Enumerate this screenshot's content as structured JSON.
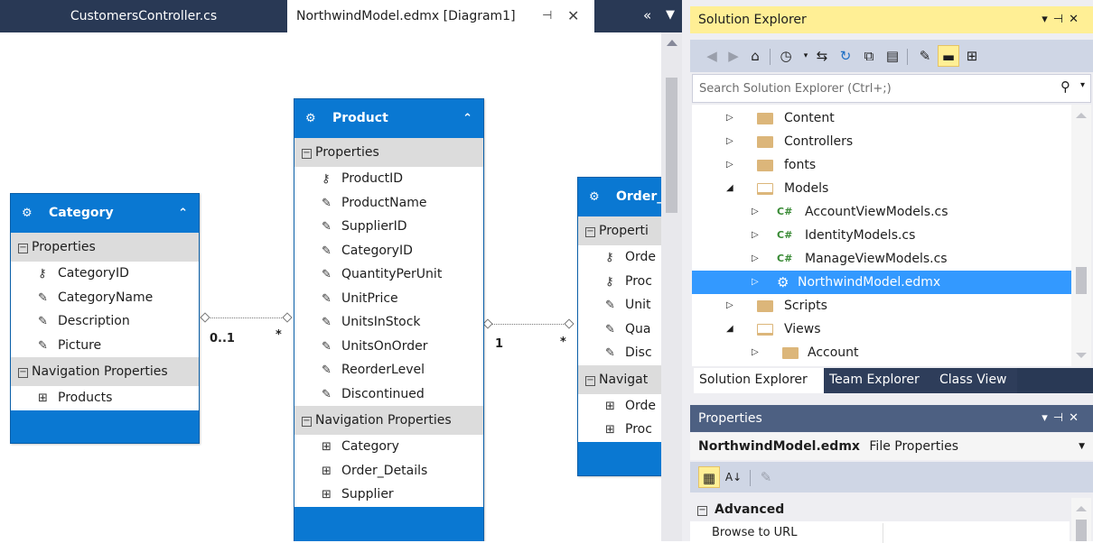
{
  "tabs": {
    "customers": "CustomersController.cs",
    "model": "NorthwindModel.edmx [Diagram1]",
    "pin_icon": "pin-icon",
    "close_icon": "close-icon",
    "overflow": "«",
    "dropdown": "▼"
  },
  "diagram": {
    "entities": {
      "category": {
        "name": "Category",
        "properties_label": "Properties",
        "properties": [
          "CategoryID",
          "CategoryName",
          "Description",
          "Picture"
        ],
        "nav_label": "Navigation Properties",
        "nav": [
          "Products"
        ]
      },
      "product": {
        "name": "Product",
        "properties_label": "Properties",
        "properties": [
          "ProductID",
          "ProductName",
          "SupplierID",
          "CategoryID",
          "QuantityPerUnit",
          "UnitPrice",
          "UnitsInStock",
          "UnitsOnOrder",
          "ReorderLevel",
          "Discontinued"
        ],
        "nav_label": "Navigation Properties",
        "nav": [
          "Category",
          "Order_Details",
          "Supplier"
        ]
      },
      "order": {
        "name": "Order_",
        "properties_label": "Properti",
        "properties": [
          "Orde",
          "Proc",
          "Unit",
          "Qua",
          "Disc"
        ],
        "nav_label": "Navigat",
        "nav": [
          "Orde",
          "Proc"
        ]
      }
    },
    "multiplicities": {
      "cat_side": "0..1",
      "prod_side_left": "*",
      "prod_side_right": "1",
      "order_side": "*"
    }
  },
  "solution_explorer": {
    "title": "Solution Explorer",
    "search_placeholder": "Search Solution Explorer (Ctrl+;)",
    "tree": [
      {
        "label": "Content",
        "type": "folder",
        "level": 1,
        "expanded": false
      },
      {
        "label": "Controllers",
        "type": "folder",
        "level": 1,
        "expanded": false
      },
      {
        "label": "fonts",
        "type": "folder",
        "level": 1,
        "expanded": false
      },
      {
        "label": "Models",
        "type": "folder",
        "level": 1,
        "expanded": true
      },
      {
        "label": "AccountViewModels.cs",
        "type": "cs",
        "level": 2
      },
      {
        "label": "IdentityModels.cs",
        "type": "cs",
        "level": 2
      },
      {
        "label": "ManageViewModels.cs",
        "type": "cs",
        "level": 2
      },
      {
        "label": "NorthwindModel.edmx",
        "type": "edmx",
        "level": 2,
        "selected": true
      },
      {
        "label": "Scripts",
        "type": "folder",
        "level": 1,
        "expanded": false
      },
      {
        "label": "Views",
        "type": "folder",
        "level": 1,
        "expanded": true
      },
      {
        "label": "Account",
        "type": "folder",
        "level": 2,
        "expanded": false
      }
    ],
    "bottom_tabs": [
      "Solution Explorer",
      "Team Explorer",
      "Class View"
    ]
  },
  "properties": {
    "title": "Properties",
    "object_name": "NorthwindModel.edmx",
    "object_type": "File Properties",
    "category": "Advanced",
    "rows": [
      {
        "name": "Browse to URL",
        "value": ""
      }
    ]
  },
  "colors": {
    "entity_blue": "#0a78d2",
    "tab_bar": "#293955",
    "active_title": "#ffef95",
    "selection": "#3399ff"
  }
}
